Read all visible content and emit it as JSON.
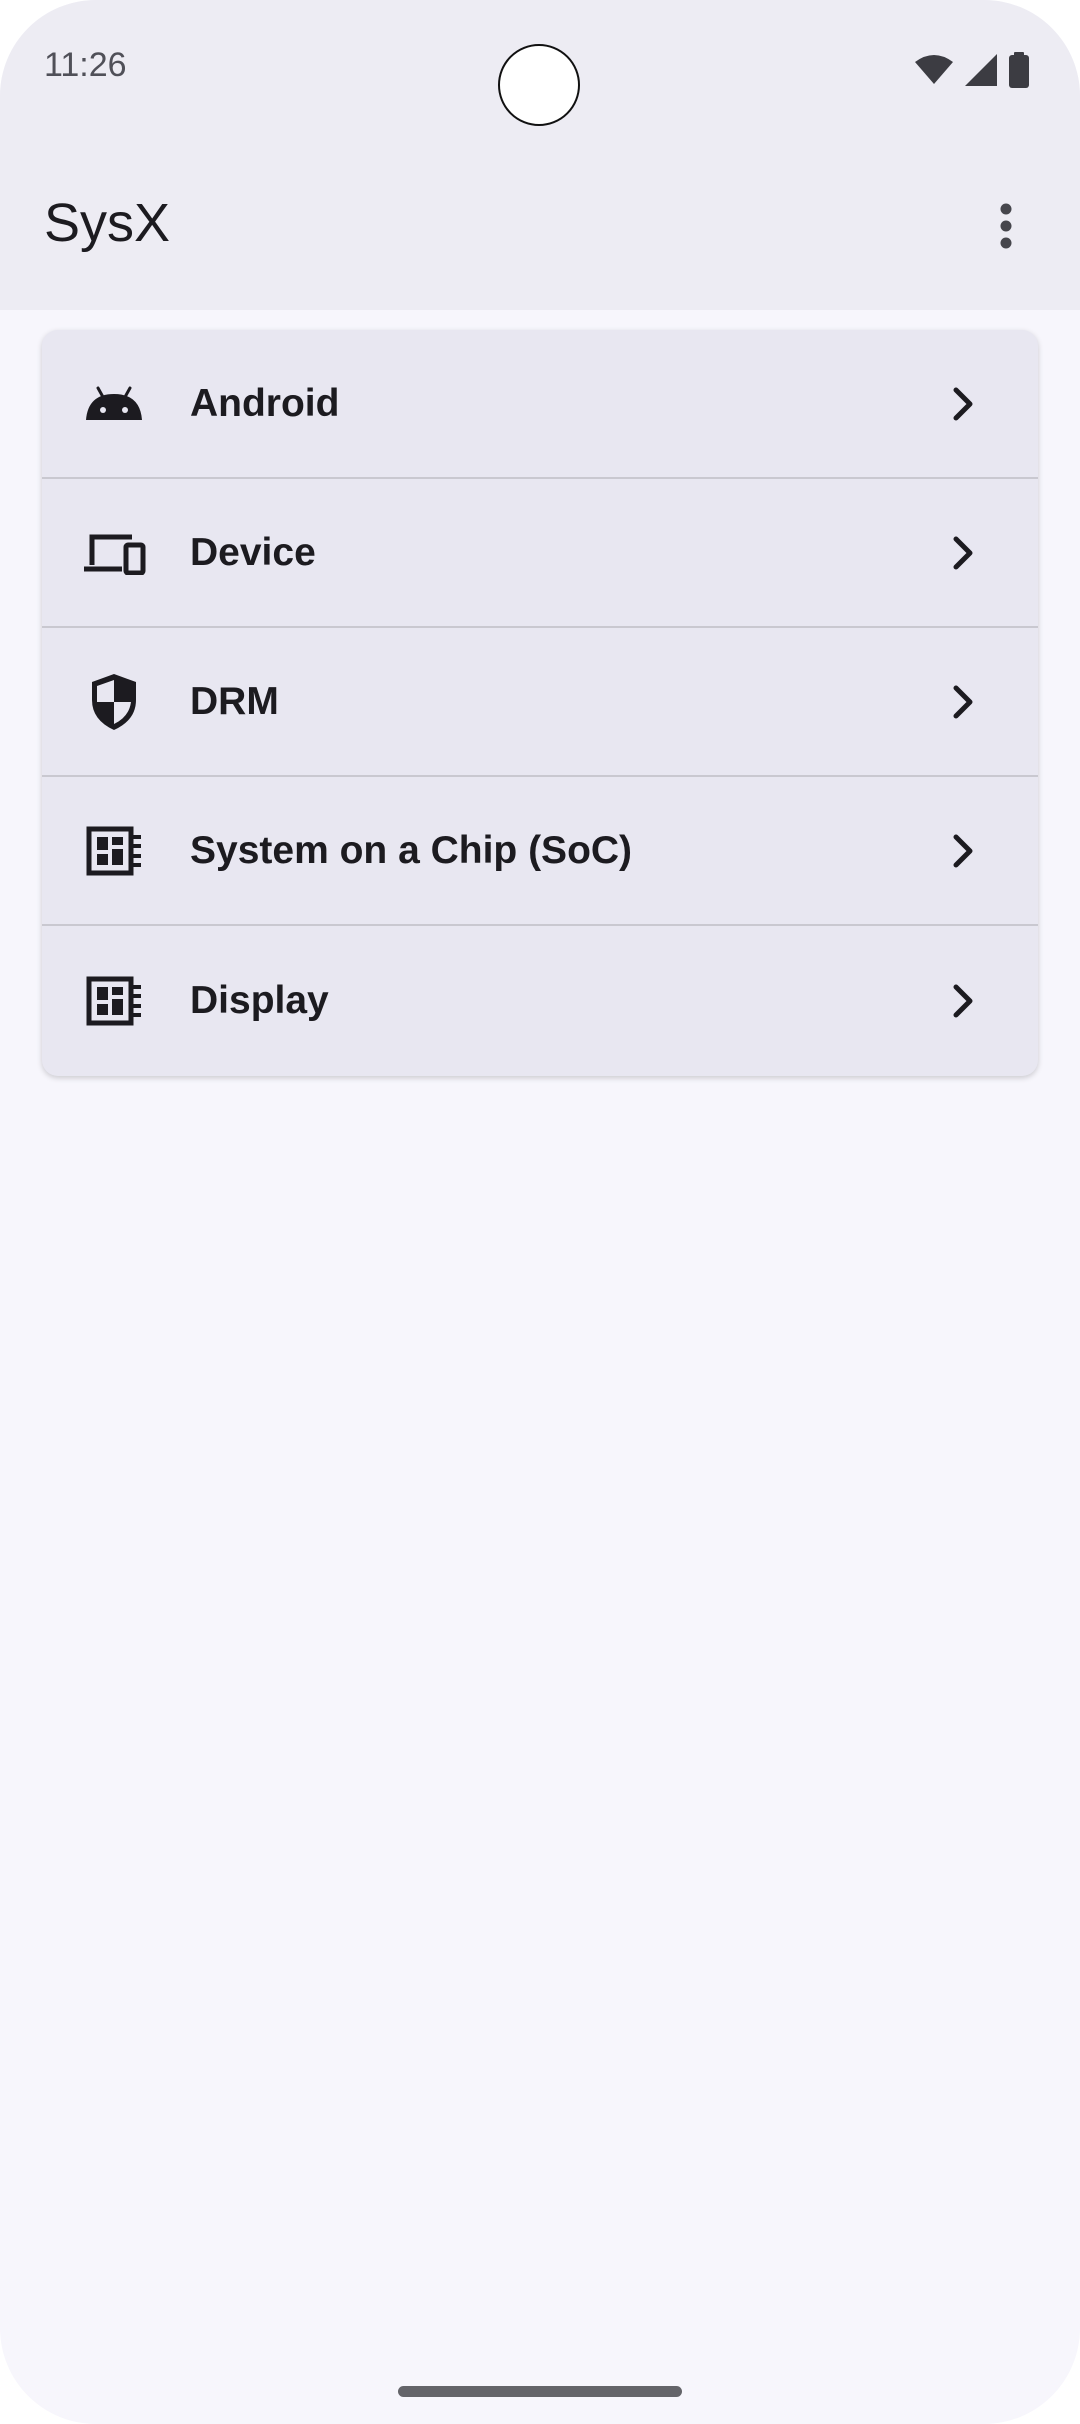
{
  "status_bar": {
    "time": "11:26"
  },
  "app_bar": {
    "title": "SysX",
    "menu_icon": "more-vert-icon"
  },
  "menu": {
    "items": [
      {
        "label": "Android",
        "icon": "android-icon"
      },
      {
        "label": "Device",
        "icon": "devices-icon"
      },
      {
        "label": "DRM",
        "icon": "shield-icon"
      },
      {
        "label": "System on a Chip (SoC)",
        "icon": "chip-icon"
      },
      {
        "label": "Display",
        "icon": "chip-icon"
      }
    ]
  },
  "colors": {
    "background": "#f7f6fc",
    "top_bar": "#edecf3",
    "card": "#e8e7f1",
    "divider": "#c9c8d0",
    "text": "#1c1b20"
  }
}
